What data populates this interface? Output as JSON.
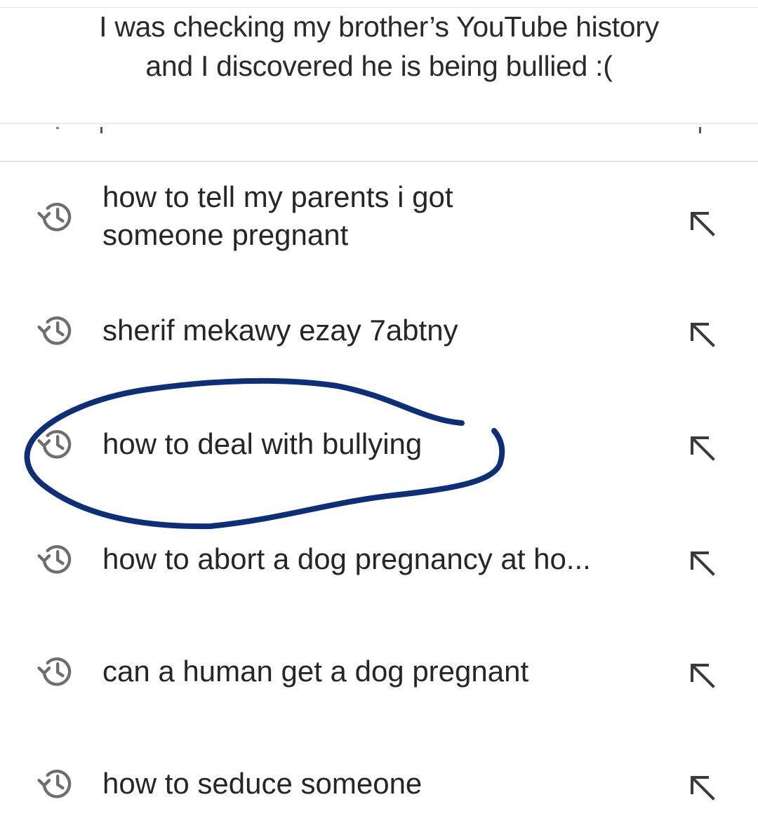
{
  "caption": {
    "line1": "I was checking my brother’s YouTube history",
    "line2": "and I discovered he is being bullied :("
  },
  "history": {
    "items": [
      {
        "text": "how to tell my parents i got someone pregnant",
        "icon": "history-icon",
        "action_icon": "fill-search-arrow-icon"
      },
      {
        "text": "sherif mekawy ezay 7abtny",
        "icon": "history-icon",
        "action_icon": "fill-search-arrow-icon"
      },
      {
        "text": "how to deal with bullying",
        "icon": "history-icon",
        "action_icon": "fill-search-arrow-icon",
        "circled": true
      },
      {
        "text": "how to abort a dog pregnancy at ho...",
        "icon": "history-icon",
        "action_icon": "fill-search-arrow-icon"
      },
      {
        "text": "can a human get a dog pregnant",
        "icon": "history-icon",
        "action_icon": "fill-search-arrow-icon"
      },
      {
        "text": "how to seduce someone",
        "icon": "history-icon",
        "action_icon": "fill-search-arrow-icon"
      }
    ]
  },
  "colors": {
    "text": "#262626",
    "icon": "#6e6e6e",
    "scribble": "#0d2f7a",
    "divider": "#e4e4e4"
  }
}
